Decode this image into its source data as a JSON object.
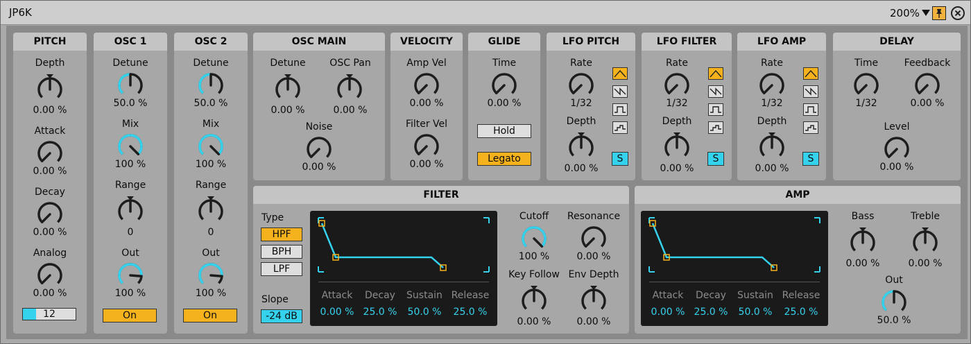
{
  "window": {
    "title": "JP6K",
    "zoom": "200%"
  },
  "icons": {
    "zoom_dropdown": "chevron-down-icon",
    "pin": "pin-icon",
    "close": "close-icon"
  },
  "colors": {
    "accent_orange": "#f5b21d",
    "accent_blue": "#35d2ee",
    "panel": "#a7a7a7",
    "panel_header": "#c4c4c4",
    "envelope_bg": "#1a1a1a"
  },
  "pitch": {
    "title": "PITCH",
    "depth": {
      "label": "Depth",
      "value": "0.00 %",
      "level": 0.5
    },
    "attack": {
      "label": "Attack",
      "value": "0.00 %",
      "level": 0.0
    },
    "decay": {
      "label": "Decay",
      "value": "0.00 %",
      "level": 0.0
    },
    "analog": {
      "label": "Analog",
      "value": "0.00 %",
      "level": 0.0
    },
    "octave": {
      "value": "12",
      "level": 0.25
    }
  },
  "osc1": {
    "title": "OSC 1",
    "detune": {
      "label": "Detune",
      "value": "50.0 %",
      "level": 0.5
    },
    "mix": {
      "label": "Mix",
      "value": "100 %",
      "level": 1.0
    },
    "range": {
      "label": "Range",
      "value": "0",
      "level": 0.5
    },
    "out": {
      "label": "Out",
      "value": "100 %",
      "level": 0.85
    },
    "toggle": "On"
  },
  "osc2": {
    "title": "OSC 2",
    "detune": {
      "label": "Detune",
      "value": "50.0 %",
      "level": 0.5
    },
    "mix": {
      "label": "Mix",
      "value": "100 %",
      "level": 1.0
    },
    "range": {
      "label": "Range",
      "value": "0",
      "level": 0.5
    },
    "out": {
      "label": "Out",
      "value": "100 %",
      "level": 0.85
    },
    "toggle": "On"
  },
  "osc_main": {
    "title": "OSC MAIN",
    "detune": {
      "label": "Detune",
      "value": "0.00 %",
      "level": 0.5
    },
    "pan": {
      "label": "OSC Pan",
      "value": "0.00 %",
      "level": 0.5
    },
    "noise": {
      "label": "Noise",
      "value": "0.00 %",
      "level": 0.0
    }
  },
  "velocity": {
    "title": "VELOCITY",
    "amp": {
      "label": "Amp Vel",
      "value": "0.00 %",
      "level": 0.0
    },
    "filter": {
      "label": "Filter Vel",
      "value": "0.00 %",
      "level": 0.0
    }
  },
  "glide": {
    "title": "GLIDE",
    "time": {
      "label": "Time",
      "value": "0.00 %",
      "level": 0.0
    },
    "hold": "Hold",
    "legato": "Legato"
  },
  "lfo_pitch": {
    "title": "LFO PITCH",
    "rate": {
      "label": "Rate",
      "value": "1/32",
      "level": 0.0
    },
    "depth": {
      "label": "Depth",
      "value": "0.00 %",
      "level": 0.5
    },
    "sync": "S"
  },
  "lfo_filter": {
    "title": "LFO FILTER",
    "rate": {
      "label": "Rate",
      "value": "1/32",
      "level": 0.0
    },
    "depth": {
      "label": "Depth",
      "value": "0.00 %",
      "level": 0.5
    },
    "sync": "S"
  },
  "lfo_amp": {
    "title": "LFO AMP",
    "rate": {
      "label": "Rate",
      "value": "1/32",
      "level": 0.0
    },
    "depth": {
      "label": "Depth",
      "value": "0.00 %",
      "level": 0.5
    },
    "sync": "S"
  },
  "delay": {
    "title": "DELAY",
    "time": {
      "label": "Time",
      "value": "1/32",
      "level": 0.0
    },
    "feedback": {
      "label": "Feedback",
      "value": "0.00 %",
      "level": 0.0
    },
    "level": {
      "label": "Level",
      "value": "0.00 %",
      "level": 0.0
    }
  },
  "filter": {
    "title": "FILTER",
    "type_label": "Type",
    "types": [
      "HPF",
      "BPH",
      "LPF"
    ],
    "slope_label": "Slope",
    "slope": "-24 dB",
    "env": {
      "attack": {
        "label": "Attack",
        "value": "0.00 %"
      },
      "decay": {
        "label": "Decay",
        "value": "25.0 %"
      },
      "sustain": {
        "label": "Sustain",
        "value": "50.0 %"
      },
      "release": {
        "label": "Release",
        "value": "25.0 %"
      }
    },
    "cutoff": {
      "label": "Cutoff",
      "value": "100 %",
      "level": 1.0
    },
    "resonance": {
      "label": "Resonance",
      "value": "0.00 %",
      "level": 0.0
    },
    "key_follow": {
      "label": "Key Follow",
      "value": "0.00 %",
      "level": 0.5
    },
    "env_depth": {
      "label": "Env Depth",
      "value": "0.00 %",
      "level": 0.5
    }
  },
  "amp": {
    "title": "AMP",
    "env": {
      "attack": {
        "label": "Attack",
        "value": "0.00 %"
      },
      "decay": {
        "label": "Decay",
        "value": "25.0 %"
      },
      "sustain": {
        "label": "Sustain",
        "value": "50.0 %"
      },
      "release": {
        "label": "Release",
        "value": "25.0 %"
      }
    },
    "bass": {
      "label": "Bass",
      "value": "0.00 %",
      "level": 0.5
    },
    "treble": {
      "label": "Treble",
      "value": "0.00 %",
      "level": 0.5
    },
    "out": {
      "label": "Out",
      "value": "50.0 %",
      "level": 0.5
    }
  }
}
